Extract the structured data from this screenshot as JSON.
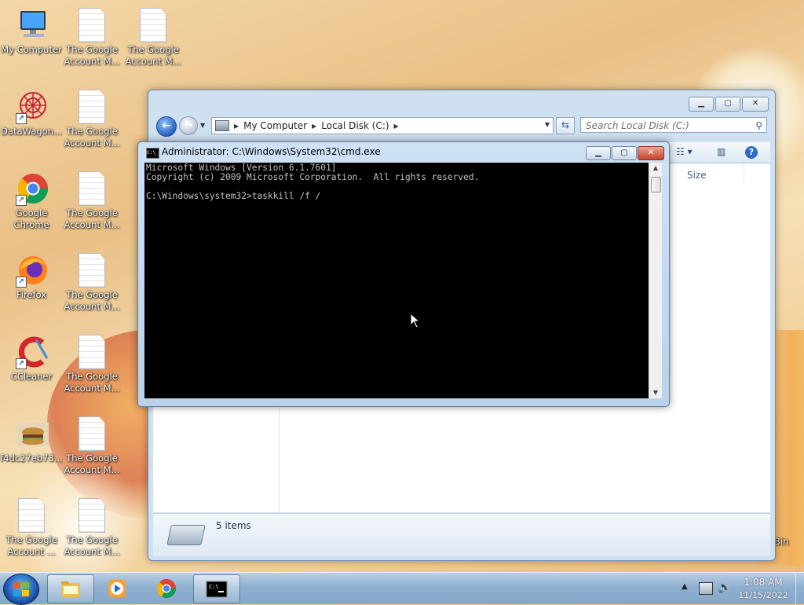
{
  "desktop": {
    "icons": [
      {
        "label": "My Computer"
      },
      {
        "label": "The Google Account M..."
      },
      {
        "label": "The Google Account M..."
      },
      {
        "label": "DataWagon..."
      },
      {
        "label": "The Google Account M..."
      },
      {
        "label": "Google Chrome"
      },
      {
        "label": "The Google Account M..."
      },
      {
        "label": "Firefox"
      },
      {
        "label": "The Google Account M..."
      },
      {
        "label": "CCleaner"
      },
      {
        "label": "The Google Account M..."
      },
      {
        "label": "f4dc27eb73..."
      },
      {
        "label": "The Google Account M..."
      },
      {
        "label": "The Google Account ..."
      },
      {
        "label": "The Google Account M..."
      }
    ],
    "recycle_bin_label_partial": "Bin"
  },
  "explorer": {
    "breadcrumb": [
      "My Computer",
      "Local Disk (C:)"
    ],
    "search_placeholder": "Search Local Disk (C:)",
    "column_header": "Size",
    "items_count": "5 items",
    "icons": {
      "back": "back-arrow-icon",
      "forward": "forward-arrow-icon",
      "refresh": "refresh-icon",
      "search": "search-icon",
      "views": "views-icon",
      "preview": "preview-pane-icon",
      "help": "help-icon"
    }
  },
  "cmd": {
    "title": "Administrator: C:\\Windows\\System32\\cmd.exe",
    "lines": [
      "Microsoft Windows [Version 6.1.7601]",
      "Copyright (c) 2009 Microsoft Corporation.  All rights reserved.",
      "",
      "C:\\Windows\\system32>taskkill /f /"
    ],
    "icon_text": "C:\\_"
  },
  "taskbar": {
    "apps": [
      "explorer",
      "media-player",
      "chrome",
      "cmd"
    ],
    "clock_time": "1:08 AM",
    "clock_date": "11/15/2022"
  },
  "colors": {
    "cmd_bg": "#000000",
    "cmd_fg": "#c0c0c0",
    "taskbar": "#90b0d0"
  }
}
